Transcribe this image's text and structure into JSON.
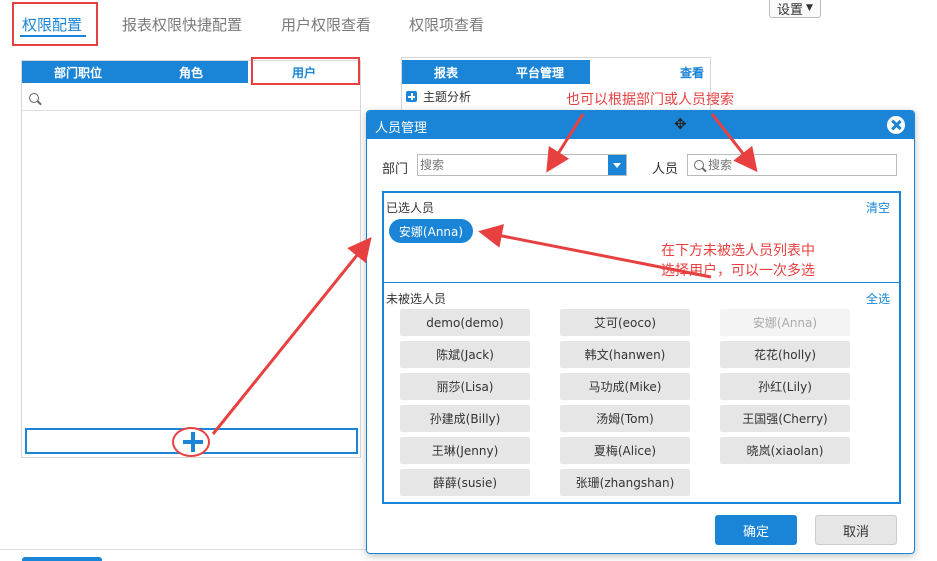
{
  "top_tabs": [
    {
      "label": "权限配置"
    },
    {
      "label": "报表权限快捷配置"
    },
    {
      "label": "用户权限查看"
    },
    {
      "label": "权限项查看"
    }
  ],
  "settings_label": "设置",
  "left_panel": {
    "tabs": [
      {
        "label": "部门职位"
      },
      {
        "label": "角色"
      },
      {
        "label": "用户"
      }
    ]
  },
  "right_panel": {
    "tabs": [
      {
        "label": "报表"
      },
      {
        "label": "平台管理"
      },
      {
        "label": "查看"
      }
    ],
    "tree_item": "主题分析"
  },
  "modal": {
    "title": "人员管理",
    "dept_label": "部门",
    "dept_placeholder": "搜索",
    "person_label": "人员",
    "person_placeholder": "搜索",
    "selected_label": "已选人员",
    "clear_label": "清空",
    "selected_users": [
      "安娜(Anna)"
    ],
    "unselected_label": "未被选人员",
    "select_all_label": "全选",
    "users": [
      {
        "name": "demo(demo)",
        "disabled": false
      },
      {
        "name": "艾可(eoco)",
        "disabled": false
      },
      {
        "name": "安娜(Anna)",
        "disabled": true
      },
      {
        "name": "陈斌(Jack)",
        "disabled": false
      },
      {
        "name": "韩文(hanwen)",
        "disabled": false
      },
      {
        "name": "花花(holly)",
        "disabled": false
      },
      {
        "name": "丽莎(Lisa)",
        "disabled": false
      },
      {
        "name": "马功成(Mike)",
        "disabled": false
      },
      {
        "name": "孙红(Lily)",
        "disabled": false
      },
      {
        "name": "孙建成(Billy)",
        "disabled": false
      },
      {
        "name": "汤姆(Tom)",
        "disabled": false
      },
      {
        "name": "王国强(Cherry)",
        "disabled": false
      },
      {
        "name": "王琳(Jenny)",
        "disabled": false
      },
      {
        "name": "夏梅(Alice)",
        "disabled": false
      },
      {
        "name": "晓岚(xiaolan)",
        "disabled": false
      },
      {
        "name": "薛薛(susie)",
        "disabled": false
      },
      {
        "name": "张珊(zhangshan)",
        "disabled": false
      }
    ],
    "ok_label": "确定",
    "cancel_label": "取消"
  },
  "annotations": {
    "search_hint": "也可以根据部门或人员搜索",
    "select_hint_line1": "在下方未被选人员列表中",
    "select_hint_line2": "选择用户，可以一次多选"
  },
  "colors": {
    "accent": "#1a85d6",
    "annotation": "#e84040"
  }
}
